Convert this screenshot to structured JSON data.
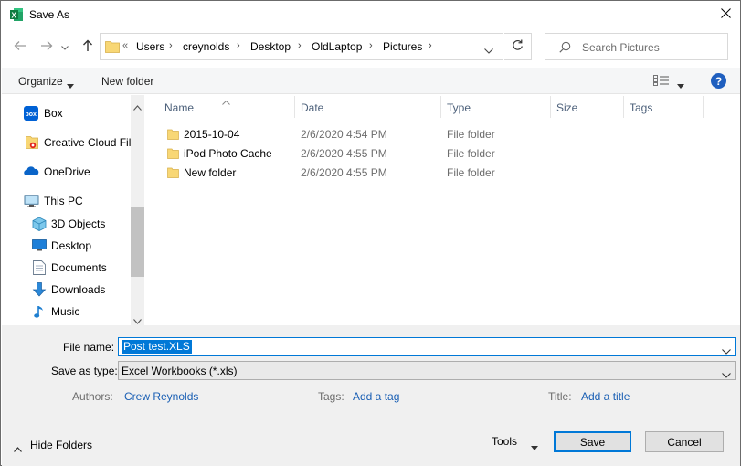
{
  "window": {
    "title": "Save As",
    "app_icon": "excel-icon"
  },
  "nav": {
    "address_crumbs": [
      "Users",
      "creynolds",
      "Desktop",
      "OldLaptop",
      "Pictures"
    ],
    "overflow": "«",
    "search_placeholder": "Search Pictures"
  },
  "toolbar": {
    "organize": "Organize",
    "new_folder": "New folder",
    "help": "?"
  },
  "sidebar": {
    "items": [
      {
        "label": "Box",
        "icon": "box-icon"
      },
      {
        "label": "Creative Cloud Fil",
        "icon": "creative-cloud-icon"
      },
      {
        "label": "OneDrive",
        "icon": "onedrive-icon"
      },
      {
        "label": "This PC",
        "icon": "this-pc-icon"
      },
      {
        "label": "3D Objects",
        "icon": "3d-objects-icon"
      },
      {
        "label": "Desktop",
        "icon": "desktop-icon"
      },
      {
        "label": "Documents",
        "icon": "documents-icon"
      },
      {
        "label": "Downloads",
        "icon": "downloads-icon"
      },
      {
        "label": "Music",
        "icon": "music-icon"
      }
    ]
  },
  "files": {
    "columns": [
      "Name",
      "Date",
      "Type",
      "Size",
      "Tags"
    ],
    "rows": [
      {
        "name": "2015-10-04",
        "date": "2/6/2020 4:54 PM",
        "type": "File folder",
        "size": ""
      },
      {
        "name": "iPod Photo Cache",
        "date": "2/6/2020 4:55 PM",
        "type": "File folder",
        "size": ""
      },
      {
        "name": "New folder",
        "date": "2/6/2020 4:55 PM",
        "type": "File folder",
        "size": ""
      }
    ]
  },
  "form": {
    "file_name_label": "File name:",
    "file_name_value": "Post test.XLS",
    "save_type_label": "Save as type:",
    "save_type_value": "Excel Workbooks (*.xls)",
    "authors_label": "Authors:",
    "authors_value": "Crew Reynolds",
    "tags_label": "Tags:",
    "tags_value": "Add a tag",
    "title_label": "Title:",
    "title_value": "Add a title"
  },
  "footer": {
    "hide_folders": "Hide Folders",
    "tools": "Tools",
    "save": "Save",
    "cancel": "Cancel"
  },
  "colors": {
    "accent": "#0078d7",
    "link": "#1a5fb4",
    "folder": "#f8d775",
    "excel_green": "#1d6f42"
  }
}
